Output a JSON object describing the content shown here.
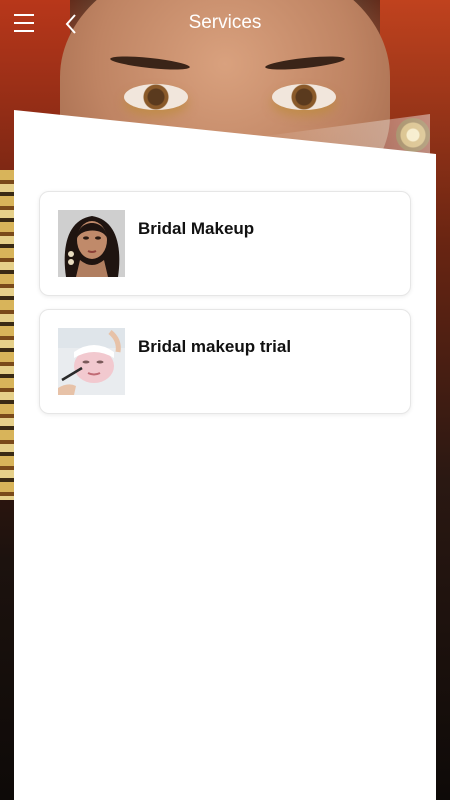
{
  "header": {
    "title": "Services",
    "menu_icon": "hamburger-menu-icon",
    "back_icon": "chevron-left-icon"
  },
  "services": [
    {
      "label": "Bridal Makeup",
      "thumbnail": "bridal-makeup-photo"
    },
    {
      "label": "Bridal makeup trial",
      "thumbnail": "facial-treatment-photo"
    }
  ],
  "colors": {
    "header_text": "#ffffff",
    "panel": "#ffffff",
    "card_border": "#e6e6e6",
    "card_text": "#111111"
  }
}
